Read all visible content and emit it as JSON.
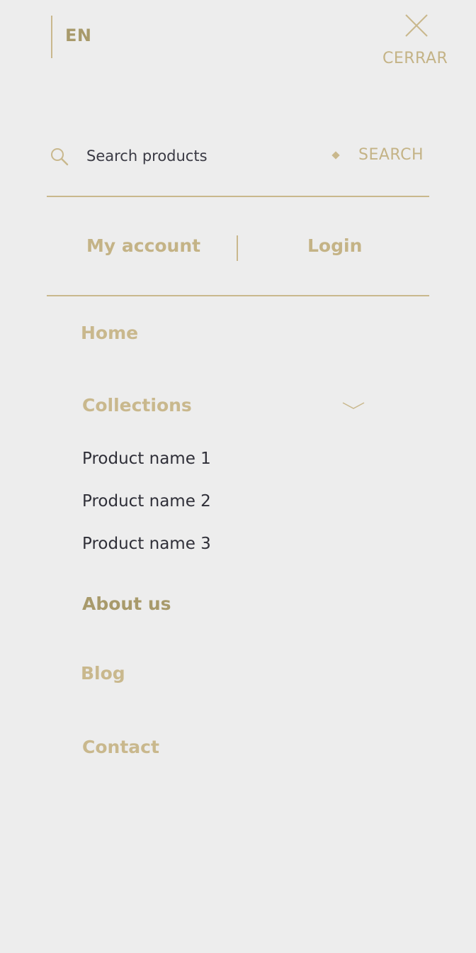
{
  "header": {
    "language": "EN",
    "close_label": "CERRAR"
  },
  "search": {
    "placeholder": "Search products",
    "button_label": "SEARCH"
  },
  "account": {
    "my_account": "My account",
    "login": "Login"
  },
  "nav": {
    "home": "Home",
    "collections": "Collections",
    "collection_items": [
      "Product name 1",
      "Product name 2",
      "Product name 3"
    ],
    "about": "About us",
    "blog": "Blog",
    "contact": "Contact"
  },
  "colors": {
    "accent": "#c9b88d",
    "accent_dark": "#a89a6b",
    "text": "#2f2f38",
    "background": "#ededed"
  },
  "icons": [
    "close-icon",
    "search-icon",
    "chevron-down-icon"
  ]
}
